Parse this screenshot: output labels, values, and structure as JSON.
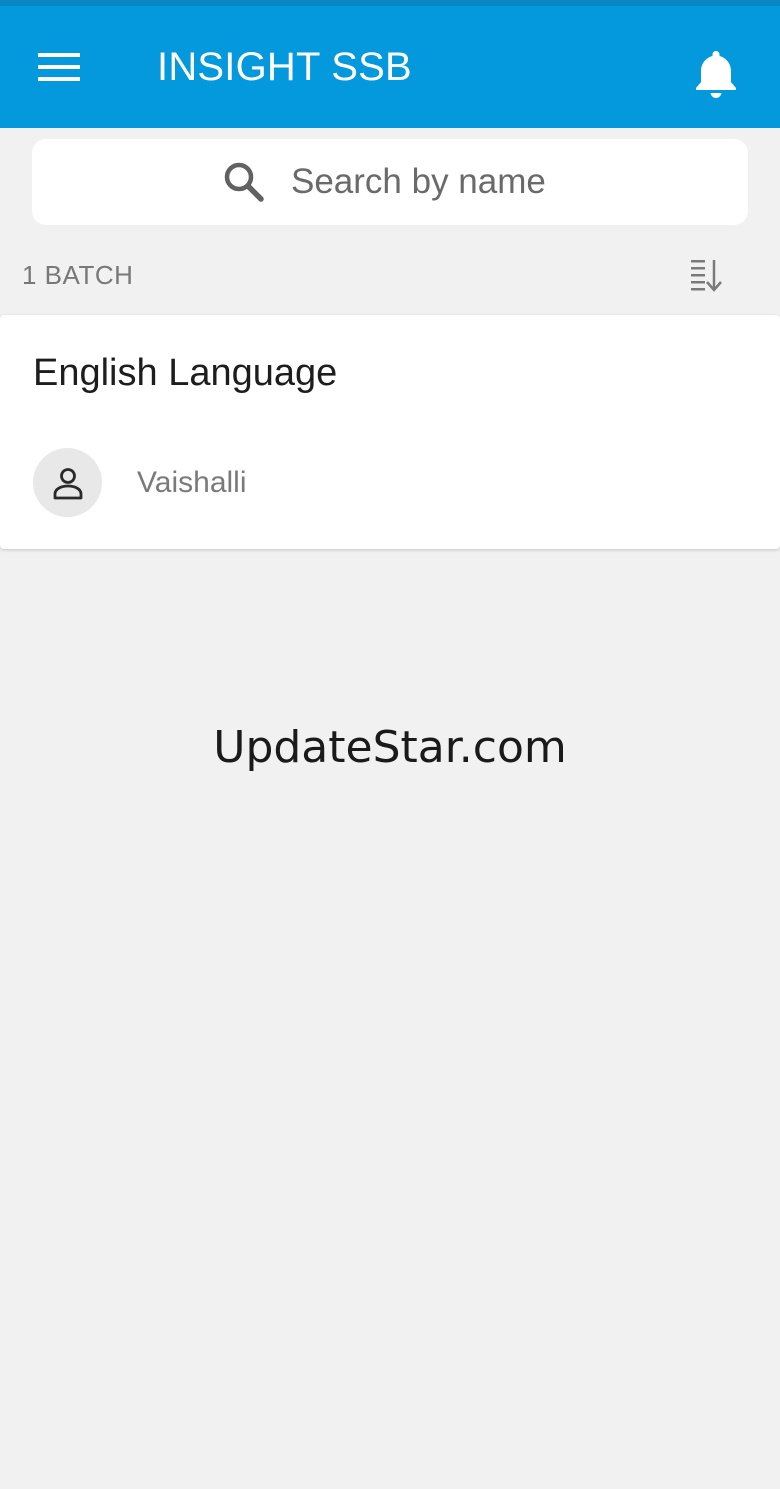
{
  "header": {
    "title": "INSIGHT SSB",
    "menu_icon": "hamburger-menu-icon",
    "notification_icon": "bell-icon",
    "background_color": "#0399dc"
  },
  "search": {
    "placeholder": "Search by name",
    "icon": "search-icon"
  },
  "batch_list": {
    "count_label": "1 BATCH",
    "sort_icon": "sort-descending-icon",
    "items": [
      {
        "name": "English Language",
        "teacher": "Vaishalli",
        "avatar_icon": "person-icon"
      }
    ]
  },
  "watermark": {
    "text": "UpdateStar.com"
  }
}
